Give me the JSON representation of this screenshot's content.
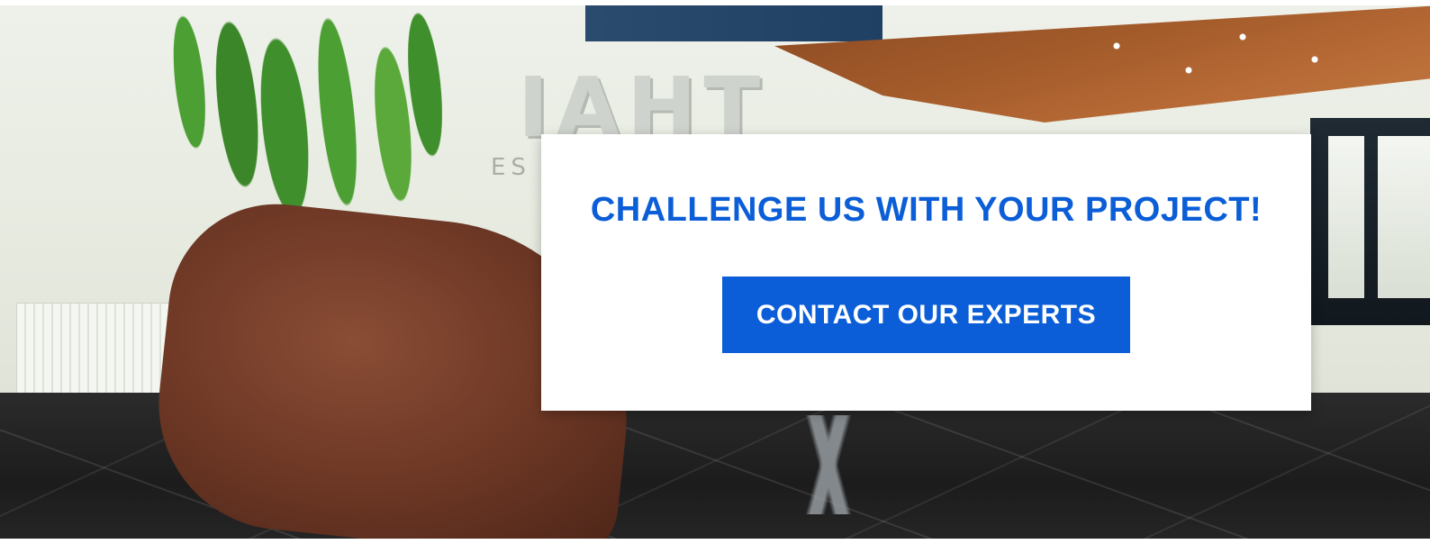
{
  "hero": {
    "background_image": "office-lobby-photo",
    "logo_text": "IAHT",
    "logo_subtext": "ES"
  },
  "cta": {
    "heading": "CHALLENGE US WITH YOUR PROJECT!",
    "button_label": "CONTACT OUR EXPERTS",
    "accent_color": "#0b5ed7",
    "card_color": "#ffffff"
  }
}
